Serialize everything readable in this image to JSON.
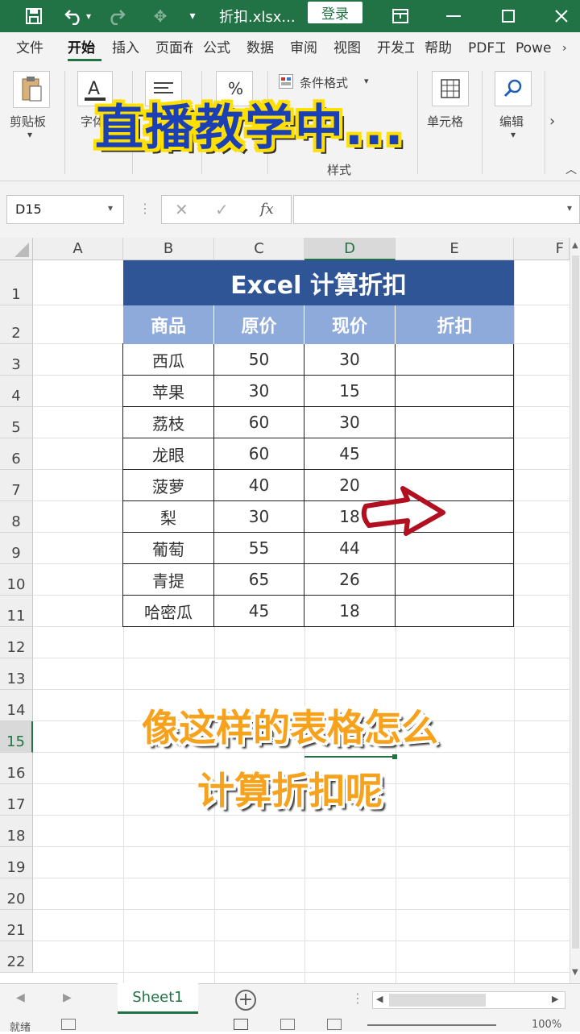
{
  "titlebar": {
    "save_icon": "save-icon",
    "undo_icon": "undo-icon",
    "redo_icon": "redo-icon",
    "title": "折扣.xlsx...",
    "login_label": "登录",
    "ribbon_display_icon": "ribbon-display-icon",
    "minimize_icon": "minimize-icon",
    "maximize_icon": "maximize-icon",
    "close_icon": "close-icon"
  },
  "menu": {
    "tabs": [
      "文件",
      "开始",
      "插入",
      "页面布",
      "公式",
      "数据",
      "审阅",
      "视图",
      "开发工",
      "帮助",
      "PDF工",
      "Powe"
    ],
    "active": "开始"
  },
  "ribbon": {
    "clipboard_label": "剪贴板",
    "font_label": "字体",
    "conditional_format_label": "条件格式",
    "cells_label": "单元格",
    "editing_label": "编辑",
    "styles_group_label": "样式"
  },
  "banner": "直播教学中...",
  "formula_bar": {
    "name_box": "D15",
    "fx_label": "fx",
    "formula": ""
  },
  "grid": {
    "columns": [
      "A",
      "B",
      "C",
      "D",
      "E",
      "F"
    ],
    "selected_column": "D",
    "rows": [
      "1",
      "2",
      "3",
      "4",
      "5",
      "6",
      "7",
      "8",
      "9",
      "10",
      "11",
      "12",
      "13",
      "14",
      "15",
      "16",
      "17",
      "18",
      "19",
      "20",
      "21",
      "22"
    ],
    "selected_row": "15"
  },
  "table": {
    "title": "Excel 计算折扣",
    "headers": [
      "商品",
      "原价",
      "现价",
      "折扣"
    ],
    "rows": [
      [
        "西瓜",
        "50",
        "30",
        ""
      ],
      [
        "苹果",
        "30",
        "15",
        ""
      ],
      [
        "荔枝",
        "60",
        "30",
        ""
      ],
      [
        "龙眼",
        "60",
        "45",
        ""
      ],
      [
        "菠萝",
        "40",
        "20",
        ""
      ],
      [
        "梨",
        "30",
        "18",
        ""
      ],
      [
        "葡萄",
        "55",
        "44",
        ""
      ],
      [
        "青提",
        "65",
        "26",
        ""
      ],
      [
        "哈密瓜",
        "45",
        "18",
        ""
      ]
    ]
  },
  "question": {
    "line1": "像这样的表格怎么",
    "line2": "计算折扣呢"
  },
  "sheets": {
    "tabs": [
      "Sheet1"
    ],
    "add_icon": "plus-icon"
  },
  "status": {
    "ready": "就绪",
    "zoom": "100%"
  },
  "colors": {
    "excel_green": "#217346",
    "table_title_bg": "#2f5597",
    "table_header_bg": "#8eaadb",
    "arrow_red": "#b01020",
    "banner_blue": "#1b3fb5",
    "banner_outline": "#ffe000",
    "question_orange": "#f6a21c"
  }
}
